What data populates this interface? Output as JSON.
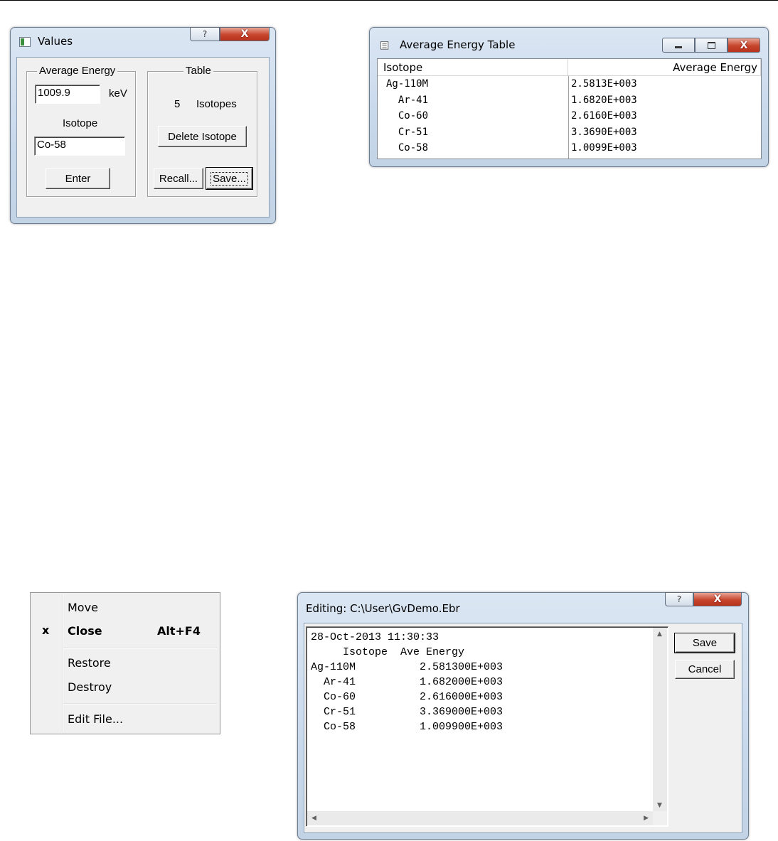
{
  "values_window": {
    "title": "Values",
    "help_glyph": "?",
    "close_glyph": "X",
    "energy_group_label": "Average Energy",
    "energy_value": "1009.9",
    "energy_unit": "keV",
    "isotope_label": "Isotope",
    "isotope_value": "Co-58",
    "enter_label": "Enter",
    "table_group_label": "Table",
    "isotope_count": "5",
    "isotope_count_label": "Isotopes",
    "delete_label": "Delete Isotope",
    "recall_label": "Recall...",
    "save_label": "Save..."
  },
  "table_window": {
    "title": "Average Energy Table",
    "columns": [
      "Isotope",
      "Average Energy"
    ],
    "rows": [
      {
        "isotope": "Ag-110M",
        "energy": "2.5813E+003"
      },
      {
        "isotope": "  Ar-41",
        "energy": "1.6820E+003"
      },
      {
        "isotope": "  Co-60",
        "energy": "2.6160E+003"
      },
      {
        "isotope": "  Cr-51",
        "energy": "3.3690E+003"
      },
      {
        "isotope": "  Co-58",
        "energy": "1.0099E+003"
      }
    ]
  },
  "context_menu": {
    "move": "Move",
    "close_check": "x",
    "close": "Close",
    "close_shortcut": "Alt+F4",
    "restore": "Restore",
    "destroy": "Destroy",
    "edit_file": "Edit File..."
  },
  "editor_window": {
    "title": "Editing: C:\\User\\GvDemo.Ebr",
    "help_glyph": "?",
    "close_glyph": "X",
    "lines": [
      "28-Oct-2013 11:30:33",
      "     Isotope  Ave Energy",
      "Ag-110M          2.581300E+003",
      "  Ar-41          1.682000E+003",
      "  Co-60          2.616000E+003",
      "  Cr-51          3.369000E+003",
      "  Co-58          1.009900E+003"
    ],
    "save_label": "Save",
    "cancel_label": "Cancel"
  }
}
